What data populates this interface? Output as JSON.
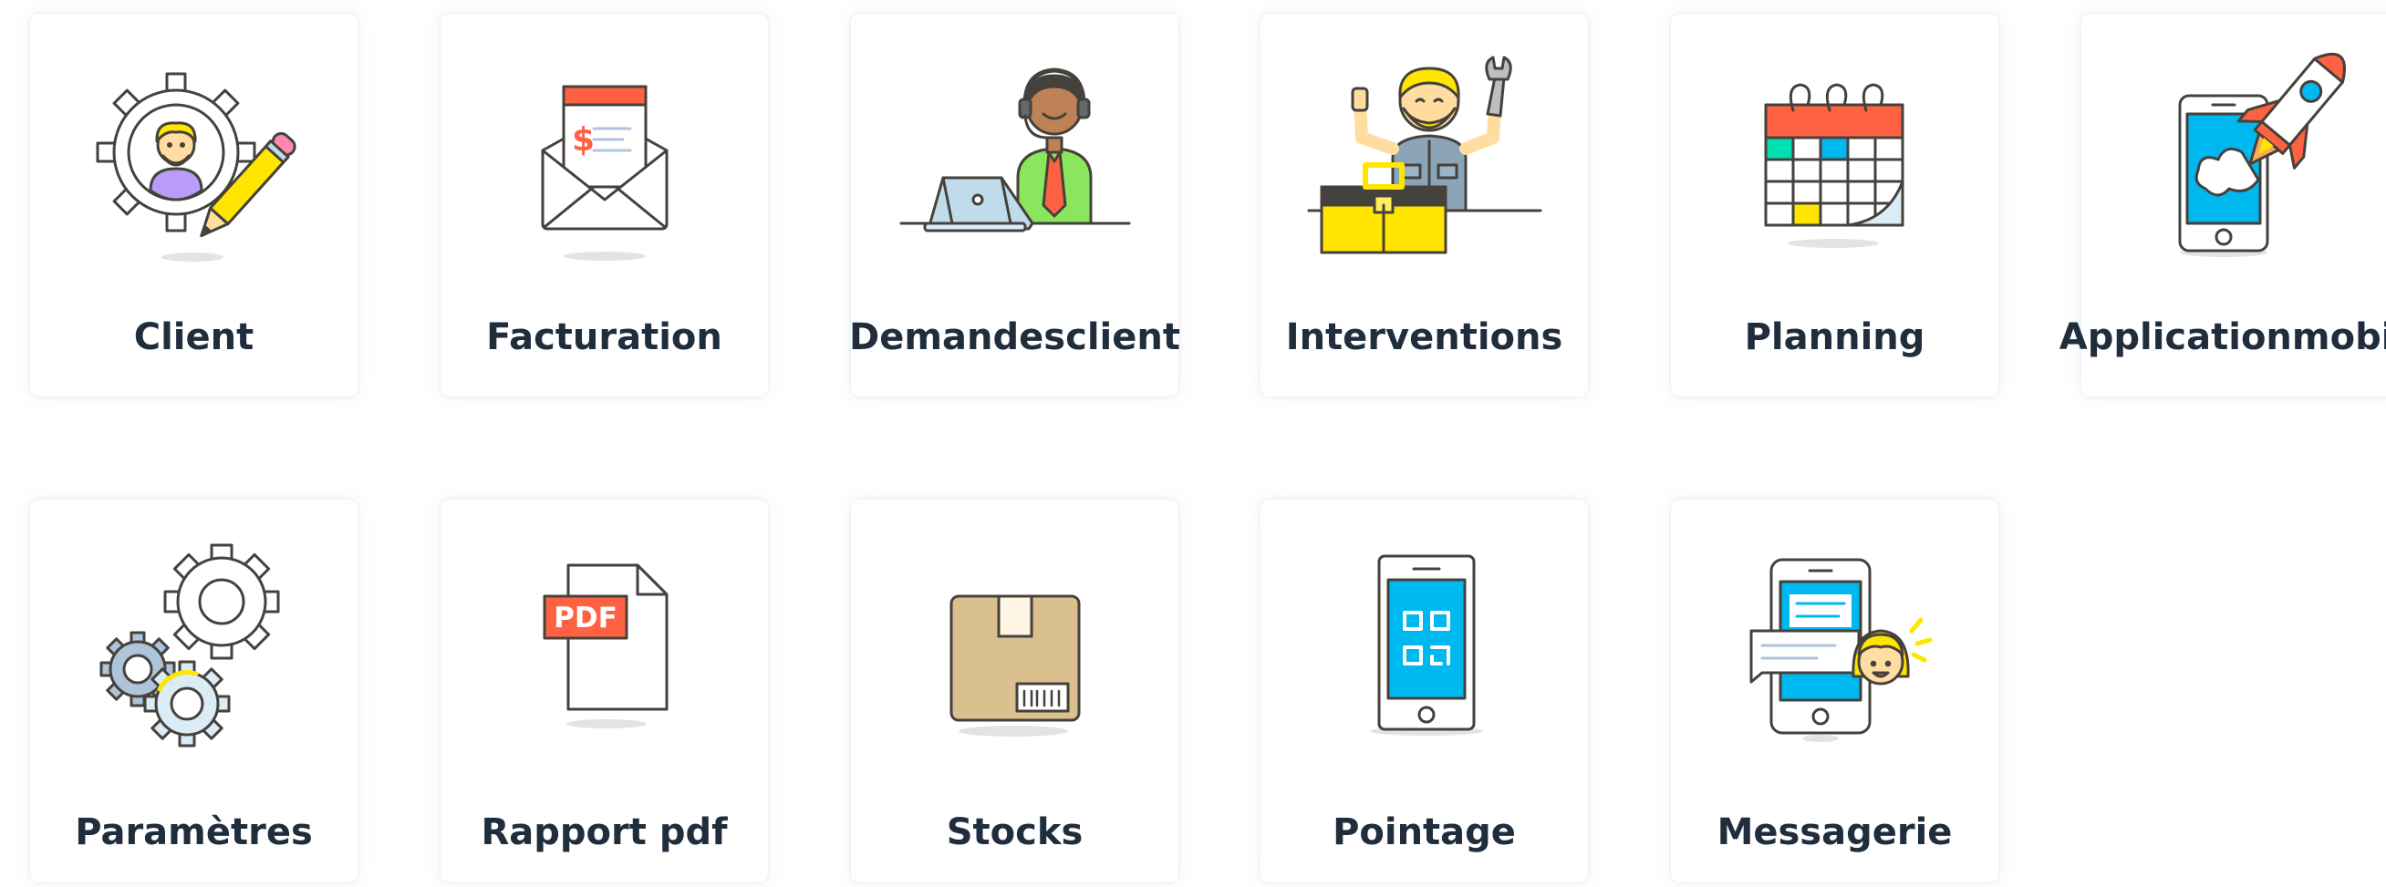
{
  "modules": [
    {
      "label": "Client",
      "icon": "client-gear-pencil-icon"
    },
    {
      "label": "Facturation",
      "icon": "invoice-envelope-icon"
    },
    {
      "label": "Demandes client",
      "label_lines": [
        "Demandes",
        "client"
      ],
      "icon": "support-agent-icon"
    },
    {
      "label": "Interventions",
      "icon": "technician-toolbox-icon"
    },
    {
      "label": "Planning",
      "icon": "calendar-icon"
    },
    {
      "label": "Application mobile",
      "label_lines": [
        "Application",
        "mobile"
      ],
      "icon": "phone-rocket-icon"
    },
    {
      "label": "Paramètres",
      "icon": "gears-icon"
    },
    {
      "label": "Rapport pdf",
      "icon": "pdf-file-icon",
      "badge": "PDF"
    },
    {
      "label": "Stocks",
      "icon": "box-icon"
    },
    {
      "label": "Pointage",
      "icon": "phone-qr-code-icon"
    },
    {
      "label": "Messagerie",
      "icon": "phone-message-icon"
    }
  ],
  "colors": {
    "outline": "#45413c",
    "text": "#1f2d3d",
    "red": "#ff6242",
    "yellow": "#ffe500",
    "sky": "#00b8f0",
    "skin": "#ffdda1",
    "cardboard": "#dabf8f"
  }
}
